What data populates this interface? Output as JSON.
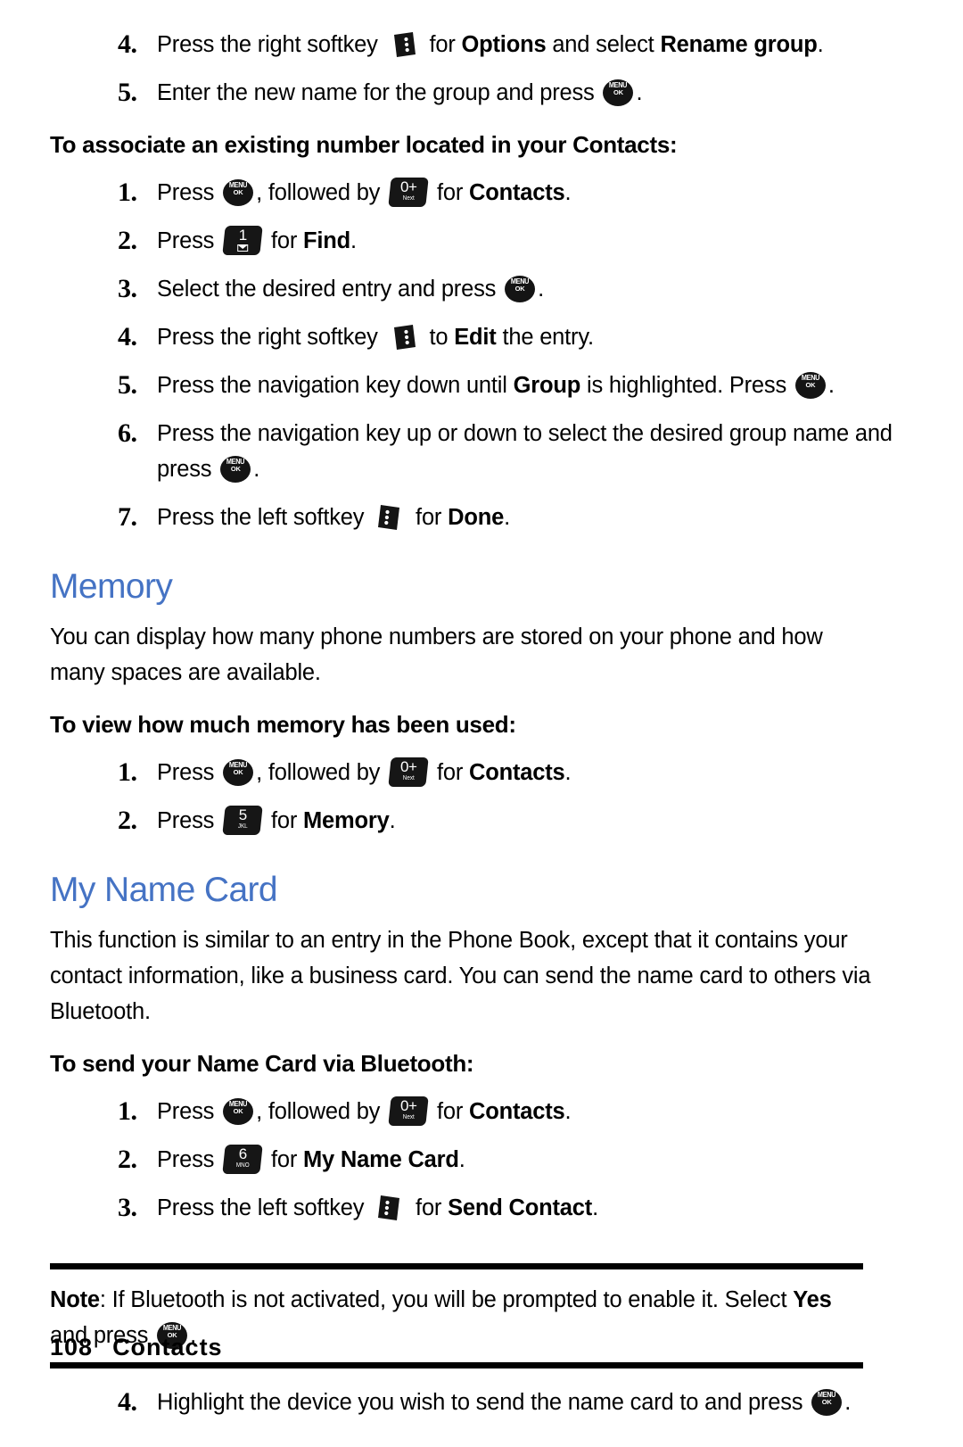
{
  "document": {
    "footer": {
      "page_number": "108",
      "section": "Contacts"
    }
  },
  "sections": [
    {
      "id": "rename-group-tail",
      "steps": [
        {
          "num": "4.",
          "parts": [
            {
              "t": "text",
              "v": "Press the right softkey "
            },
            {
              "t": "icon",
              "v": "right-softkey"
            },
            {
              "t": "text",
              "v": " for "
            },
            {
              "t": "bold",
              "v": "Options"
            },
            {
              "t": "text",
              "v": " and select "
            },
            {
              "t": "bold",
              "v": "Rename group"
            },
            {
              "t": "text",
              "v": "."
            }
          ]
        },
        {
          "num": "5.",
          "parts": [
            {
              "t": "text",
              "v": "Enter the new name for the group and press "
            },
            {
              "t": "icon",
              "v": "menu-ok-key"
            },
            {
              "t": "text",
              "v": "."
            }
          ]
        }
      ]
    },
    {
      "id": "associate-existing-number",
      "sub_head": "To associate an existing number located in your Contacts:",
      "steps": [
        {
          "num": "1.",
          "parts": [
            {
              "t": "text",
              "v": "Press "
            },
            {
              "t": "icon",
              "v": "menu-ok-key"
            },
            {
              "t": "text",
              "v": ", followed by "
            },
            {
              "t": "icon",
              "v": "key-0-next"
            },
            {
              "t": "text",
              "v": " for "
            },
            {
              "t": "bold",
              "v": "Contacts"
            },
            {
              "t": "text",
              "v": "."
            }
          ]
        },
        {
          "num": "2.",
          "parts": [
            {
              "t": "text",
              "v": "Press "
            },
            {
              "t": "icon",
              "v": "key-1-mail"
            },
            {
              "t": "text",
              "v": " for "
            },
            {
              "t": "bold",
              "v": "Find"
            },
            {
              "t": "text",
              "v": "."
            }
          ]
        },
        {
          "num": "3.",
          "parts": [
            {
              "t": "text",
              "v": "Select the desired entry and press "
            },
            {
              "t": "icon",
              "v": "menu-ok-key"
            },
            {
              "t": "text",
              "v": "."
            }
          ]
        },
        {
          "num": "4.",
          "parts": [
            {
              "t": "text",
              "v": "Press the right softkey "
            },
            {
              "t": "icon",
              "v": "right-softkey"
            },
            {
              "t": "text",
              "v": " to "
            },
            {
              "t": "bold",
              "v": "Edit"
            },
            {
              "t": "text",
              "v": " the entry."
            }
          ]
        },
        {
          "num": "5.",
          "parts": [
            {
              "t": "text",
              "v": "Press the navigation key down until "
            },
            {
              "t": "bold",
              "v": "Group"
            },
            {
              "t": "text",
              "v": " is highlighted. Press "
            },
            {
              "t": "icon",
              "v": "menu-ok-key"
            },
            {
              "t": "text",
              "v": "."
            }
          ]
        },
        {
          "num": "6.",
          "parts": [
            {
              "t": "text",
              "v": "Press the navigation key up or down to select the desired group name and press "
            },
            {
              "t": "icon",
              "v": "menu-ok-key"
            },
            {
              "t": "text",
              "v": "."
            }
          ]
        },
        {
          "num": "7.",
          "parts": [
            {
              "t": "text",
              "v": "Press the left softkey "
            },
            {
              "t": "icon",
              "v": "left-softkey"
            },
            {
              "t": "text",
              "v": " for "
            },
            {
              "t": "bold",
              "v": "Done"
            },
            {
              "t": "text",
              "v": "."
            }
          ]
        }
      ]
    },
    {
      "id": "memory",
      "sec_head": "Memory",
      "paragraphs": [
        "You can display how many phone numbers are stored on your phone and how many spaces are available."
      ],
      "sub_head": "To view how much memory has been used:",
      "steps": [
        {
          "num": "1.",
          "parts": [
            {
              "t": "text",
              "v": "Press "
            },
            {
              "t": "icon",
              "v": "menu-ok-key"
            },
            {
              "t": "text",
              "v": ", followed by "
            },
            {
              "t": "icon",
              "v": "key-0-next"
            },
            {
              "t": "text",
              "v": " for "
            },
            {
              "t": "bold",
              "v": "Contacts"
            },
            {
              "t": "text",
              "v": "."
            }
          ]
        },
        {
          "num": "2.",
          "parts": [
            {
              "t": "text",
              "v": "Press "
            },
            {
              "t": "icon",
              "v": "key-5-jkl"
            },
            {
              "t": "text",
              "v": " for "
            },
            {
              "t": "bold",
              "v": "Memory"
            },
            {
              "t": "text",
              "v": "."
            }
          ]
        }
      ]
    },
    {
      "id": "my-name-card",
      "sec_head": "My Name Card",
      "paragraphs": [
        "This function is similar to an entry in the Phone Book, except that it contains your contact information, like a business card. You can send the name card to others via Bluetooth."
      ],
      "sub_head": "To send your Name Card via Bluetooth:",
      "steps": [
        {
          "num": "1.",
          "parts": [
            {
              "t": "text",
              "v": "Press "
            },
            {
              "t": "icon",
              "v": "menu-ok-key"
            },
            {
              "t": "text",
              "v": ", followed by "
            },
            {
              "t": "icon",
              "v": "key-0-next"
            },
            {
              "t": "text",
              "v": " for "
            },
            {
              "t": "bold",
              "v": "Contacts"
            },
            {
              "t": "text",
              "v": "."
            }
          ]
        },
        {
          "num": "2.",
          "parts": [
            {
              "t": "text",
              "v": "Press "
            },
            {
              "t": "icon",
              "v": "key-6-mno"
            },
            {
              "t": "text",
              "v": " for "
            },
            {
              "t": "bold",
              "v": "My Name Card"
            },
            {
              "t": "text",
              "v": "."
            }
          ]
        },
        {
          "num": "3.",
          "parts": [
            {
              "t": "text",
              "v": "Press the left softkey "
            },
            {
              "t": "icon",
              "v": "left-softkey"
            },
            {
              "t": "text",
              "v": " for "
            },
            {
              "t": "bold",
              "v": "Send Contact"
            },
            {
              "t": "text",
              "v": "."
            }
          ]
        }
      ]
    },
    {
      "id": "note-block",
      "note": {
        "label": "Note",
        "parts": [
          {
            "t": "bold",
            "v": "Note"
          },
          {
            "t": "text",
            "v": ": If Bluetooth is not activated, you will be prompted to enable it. Select "
          },
          {
            "t": "bold",
            "v": "Yes"
          },
          {
            "t": "text",
            "v": " and press "
          },
          {
            "t": "icon",
            "v": "menu-ok-key"
          },
          {
            "t": "text",
            "v": "."
          }
        ]
      }
    },
    {
      "id": "after-note",
      "steps": [
        {
          "num": "4.",
          "parts": [
            {
              "t": "text",
              "v": "Highlight the device you wish to send the name card to and press "
            },
            {
              "t": "icon",
              "v": "menu-ok-key"
            },
            {
              "t": "text",
              "v": "."
            }
          ]
        }
      ]
    }
  ],
  "icons": {
    "menu-ok-key": {
      "line1": "MENU",
      "line2": "OK"
    },
    "key-0-next": {
      "digit": "0+",
      "sub": "Next"
    },
    "key-1-mail": {
      "digit": "1",
      "sub": "envelope"
    },
    "key-5-jkl": {
      "digit": "5",
      "sub": "JKL"
    },
    "key-6-mno": {
      "digit": "6",
      "sub": "MNO"
    },
    "right-softkey": {
      "shape": "flag-right",
      "dots": 3
    },
    "left-softkey": {
      "shape": "flag-left",
      "dots": 3
    }
  },
  "colors": {
    "section_heading": "#4573C4",
    "text": "#000000",
    "rule": "#000000",
    "background": "#FFFFFF"
  }
}
